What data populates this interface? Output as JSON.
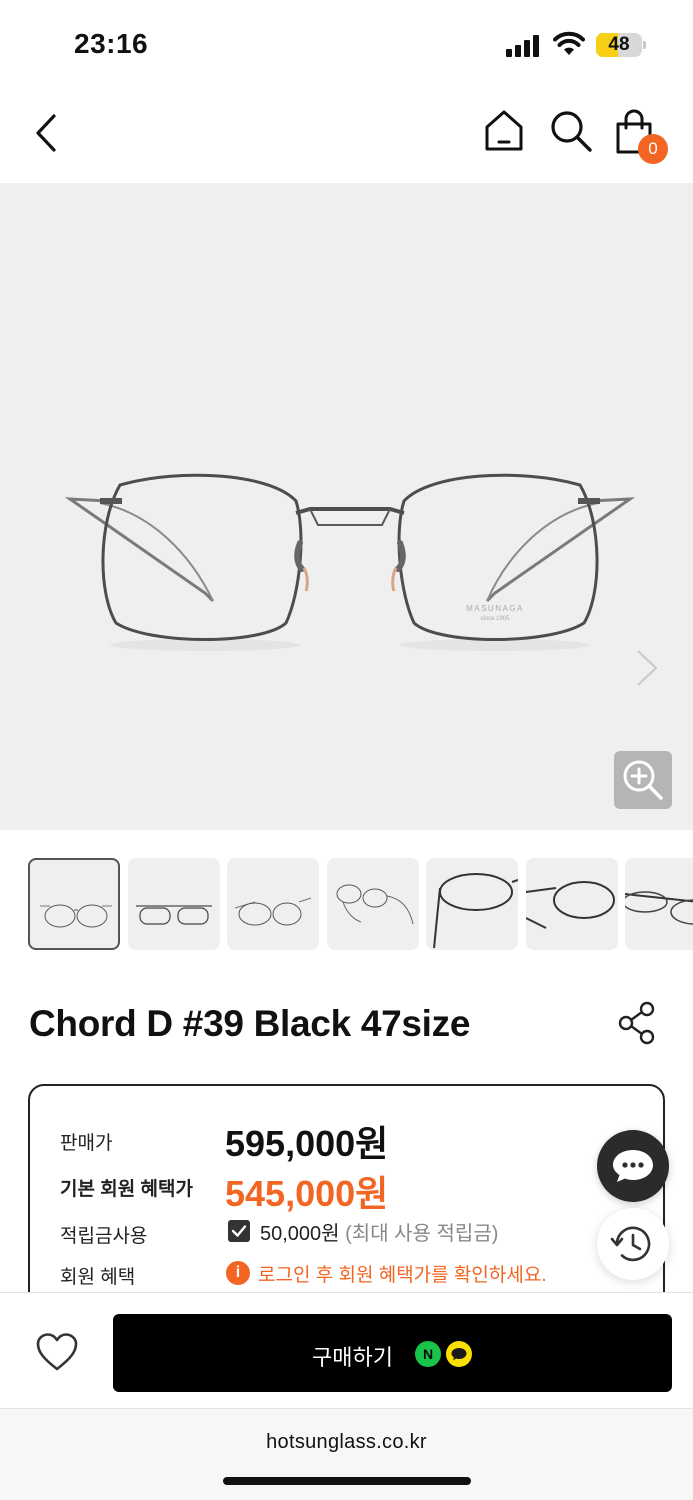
{
  "status_bar": {
    "time": "23:16",
    "battery_level": "48",
    "battery_fraction": 0.48
  },
  "nav": {
    "cart_count": "0"
  },
  "product": {
    "title": "Chord D #39 Black 47size",
    "image_brand_mark": "MASUNAGA",
    "image_brand_since": "since 1905"
  },
  "price_box": {
    "sale_label": "판매가",
    "sale_price": "595,000원",
    "member_label": "기본 회원 혜택가",
    "member_price": "545,000원",
    "points_label": "적립금사용",
    "points_value": "50,000원",
    "points_note": "(최대 사용 적립금)",
    "points_checked": true,
    "benefit_label": "회원 혜택",
    "benefit_note": "로그인 후 회원 혜택가를 확인하세요.",
    "info_icon_glyph": "i"
  },
  "buy_bar": {
    "buy_label": "구매하기",
    "npay_glyph": "N"
  },
  "browser": {
    "url": "hotsunglass.co.kr"
  },
  "colors": {
    "accent": "#f26522",
    "buy_button": "#000000",
    "npay": "#19c44a",
    "kpay": "#f9e000",
    "hero_bg": "#efefef"
  },
  "thumbnails": [
    {
      "view": "front",
      "active": true
    },
    {
      "view": "front-flat",
      "active": false
    },
    {
      "view": "front-angle",
      "active": false
    },
    {
      "view": "side-angle",
      "active": false
    },
    {
      "view": "temple-closeup",
      "active": false
    },
    {
      "view": "hinge-closeup",
      "active": false
    },
    {
      "view": "side",
      "active": false
    }
  ]
}
